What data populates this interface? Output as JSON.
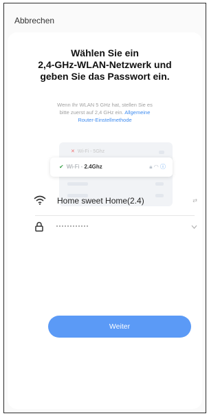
{
  "header": {
    "cancel_label": "Abbrechen"
  },
  "title": {
    "line1": "Wählen Sie ein",
    "line2": "2,4-GHz-WLAN-Netzwerk und",
    "line3": "geben Sie das Passwort ein."
  },
  "description": {
    "line1": "Wenn Ihr WLAN 5 GHz hat, stellen Sie es",
    "line2_text": "bitte zuerst auf 2,4 GHz ein. ",
    "line2_link": "Allgemeine",
    "line3_link": "Router-Einstellmethode"
  },
  "illustration": {
    "row_5ghz_prefix": "Wi-Fi - ",
    "row_5ghz_band": "5Ghz",
    "row_24ghz_prefix": "Wi-Fi - ",
    "row_24ghz_band": "2.4Ghz"
  },
  "form": {
    "ssid_value": "Home sweet Home(2.4)",
    "password_value": "············"
  },
  "submit_label": "Weiter",
  "colors": {
    "accent": "#5b9af6",
    "link": "#3f8cf0"
  }
}
